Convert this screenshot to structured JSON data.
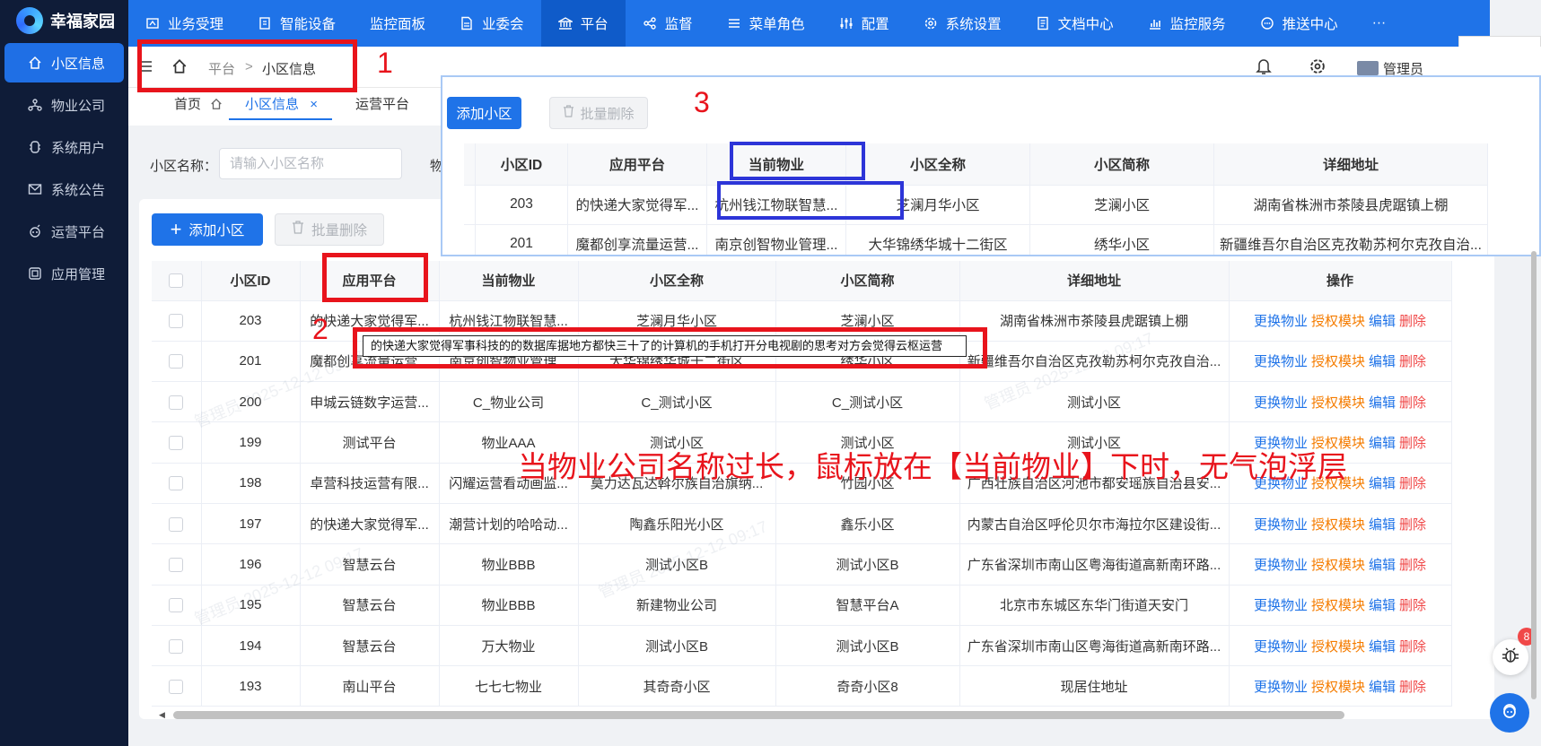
{
  "app": {
    "name": "幸福家园"
  },
  "sidebar": {
    "items": [
      {
        "label": "小区信息",
        "icon": "home-icon",
        "active": true
      },
      {
        "label": "物业公司",
        "icon": "org-icon"
      },
      {
        "label": "系统用户",
        "icon": "user-icon"
      },
      {
        "label": "系统公告",
        "icon": "mail-icon"
      },
      {
        "label": "运营平台",
        "icon": "robot-icon"
      },
      {
        "label": "应用管理",
        "icon": "app-icon"
      }
    ]
  },
  "topnav": {
    "items": [
      {
        "label": "业务受理",
        "icon": "briefcase-icon"
      },
      {
        "label": "智能设备",
        "icon": "device-icon"
      },
      {
        "label": "监控面板",
        "icon": "none"
      },
      {
        "label": "业委会",
        "icon": "doc-icon"
      },
      {
        "label": "平台",
        "icon": "bank-icon",
        "active": true
      },
      {
        "label": "监督",
        "icon": "share-icon"
      },
      {
        "label": "菜单角色",
        "icon": "list-icon"
      },
      {
        "label": "配置",
        "icon": "sliders-icon"
      },
      {
        "label": "系统设置",
        "icon": "gear-icon"
      },
      {
        "label": "文档中心",
        "icon": "file-icon"
      },
      {
        "label": "监控服务",
        "icon": "chart-icon"
      },
      {
        "label": "推送中心",
        "icon": "chat-icon"
      },
      {
        "label": "···",
        "icon": "none"
      }
    ]
  },
  "header": {
    "breadcrumb_parent": "平台",
    "breadcrumb_sep": ">",
    "breadcrumb_current": "小区信息",
    "user": "管理员"
  },
  "tabs": [
    {
      "label": "首页",
      "closable": false
    },
    {
      "label": "小区信息",
      "active": true,
      "close": "×"
    },
    {
      "label": "运营平台"
    }
  ],
  "search": {
    "label": "小区名称：",
    "placeholder": "请输入小区名称",
    "label2": "物"
  },
  "toolbar": {
    "add": "添加小区",
    "add_icon": "+",
    "delete": "批量删除"
  },
  "table": {
    "columns": [
      "小区ID",
      "应用平台",
      "当前物业",
      "小区全称",
      "小区简称",
      "详细地址",
      "操作"
    ],
    "ops": [
      "更换物业",
      "授权模块",
      "编辑",
      "删除"
    ],
    "rows": [
      {
        "id": "203",
        "platform": "的快递大家觉得军...",
        "property": "杭州钱江物联智慧...",
        "full": "芝澜月华小区",
        "short": "芝澜小区",
        "addr": "湖南省株洲市茶陵县虎踞镇上棚"
      },
      {
        "id": "201",
        "platform": "魔都创享流量运营...",
        "property": "南京创智物业管理...",
        "full": "大华锦绣华城十二街区",
        "short": "绣华小区",
        "addr": "新疆维吾尔自治区克孜勒苏柯尔克孜自治..."
      },
      {
        "id": "200",
        "platform": "申城云链数字运营...",
        "property": "C_物业公司",
        "full": "C_测试小区",
        "short": "C_测试小区",
        "addr": "测试小区"
      },
      {
        "id": "199",
        "platform": "测试平台",
        "property": "物业AAA",
        "full": "测试小区",
        "short": "测试小区",
        "addr": "测试小区"
      },
      {
        "id": "198",
        "platform": "卓营科技运营有限...",
        "property": "闪耀运营看动画监...",
        "full": "莫力达瓦达斡尔族自治旗纳...",
        "short": "竹园小区",
        "addr": "广西壮族自治区河池市都安瑶族自治县安..."
      },
      {
        "id": "197",
        "platform": "的快递大家觉得军...",
        "property": "潮营计划的哈哈动...",
        "full": "陶鑫乐阳光小区",
        "short": "鑫乐小区",
        "addr": "内蒙古自治区呼伦贝尔市海拉尔区建设街..."
      },
      {
        "id": "196",
        "platform": "智慧云台",
        "property": "物业BBB",
        "full": "测试小区B",
        "short": "测试小区B",
        "addr": "广东省深圳市南山区粤海街道高新南环路..."
      },
      {
        "id": "195",
        "platform": "智慧云台",
        "property": "物业BBB",
        "full": "新建物业公司",
        "short": "智慧平台A",
        "addr": "北京市东城区东华门街道天安门"
      },
      {
        "id": "194",
        "platform": "智慧云台",
        "property": "万大物业",
        "full": "测试小区B",
        "short": "测试小区B",
        "addr": "广东省深圳市南山区粤海街道高新南环路..."
      },
      {
        "id": "193",
        "platform": "南山平台",
        "property": "七七七物业",
        "full": "其奇奇小区",
        "short": "奇奇小区8",
        "addr": "现居住地址"
      }
    ]
  },
  "tooltip": {
    "text": "的快递大家觉得军事科技的的数据库据地方都快三十了的计算机的手机打开分电视剧的思考对方会觉得云枢运营"
  },
  "annotations": {
    "n1": "1",
    "n2": "2",
    "n3": "3",
    "caption": "当物业公司名称过长，鼠标放在【当前物业】下时，无气泡浮层"
  },
  "overlay": {
    "add": "添加小区",
    "delete": "批量删除",
    "columns": [
      "小区ID",
      "应用平台",
      "当前物业",
      "小区全称",
      "小区简称",
      "详细地址"
    ],
    "rows": [
      {
        "id": "203",
        "platform": "的快递大家觉得军...",
        "property": "杭州钱江物联智慧...",
        "full": "芝澜月华小区",
        "short": "芝澜小区",
        "addr": "湖南省株洲市茶陵县虎踞镇上棚"
      },
      {
        "id": "201",
        "platform": "魔都创享流量运营...",
        "property": "南京创智物业管理...",
        "full": "大华锦绣华城十二街区",
        "short": "绣华小区",
        "addr": "新疆维吾尔自治区克孜勒苏柯尔克孜自治..."
      }
    ]
  },
  "floating": {
    "badge": "8"
  },
  "watermark": {
    "text": "管理员 2025-12-12 09:17"
  },
  "colors": {
    "primary": "#1f73e8",
    "sidebar": "#0f1c38",
    "annotation_red": "#e8141c",
    "annotation_blue": "#2d35d8",
    "op_orange": "#f57c00",
    "op_red": "#f04848"
  }
}
